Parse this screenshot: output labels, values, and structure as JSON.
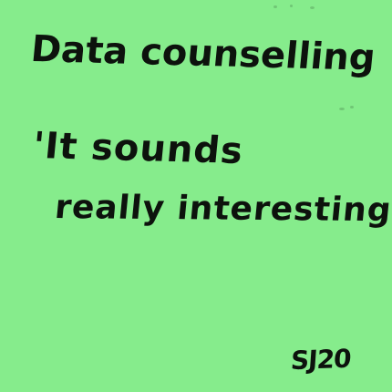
{
  "note": {
    "background_color": "#86ec8c",
    "ink_color": "#0d120d",
    "title": "Data counselling",
    "quote_line_1": "'It sounds",
    "quote_line_2": "really interesting'",
    "signature": "SJ20"
  }
}
